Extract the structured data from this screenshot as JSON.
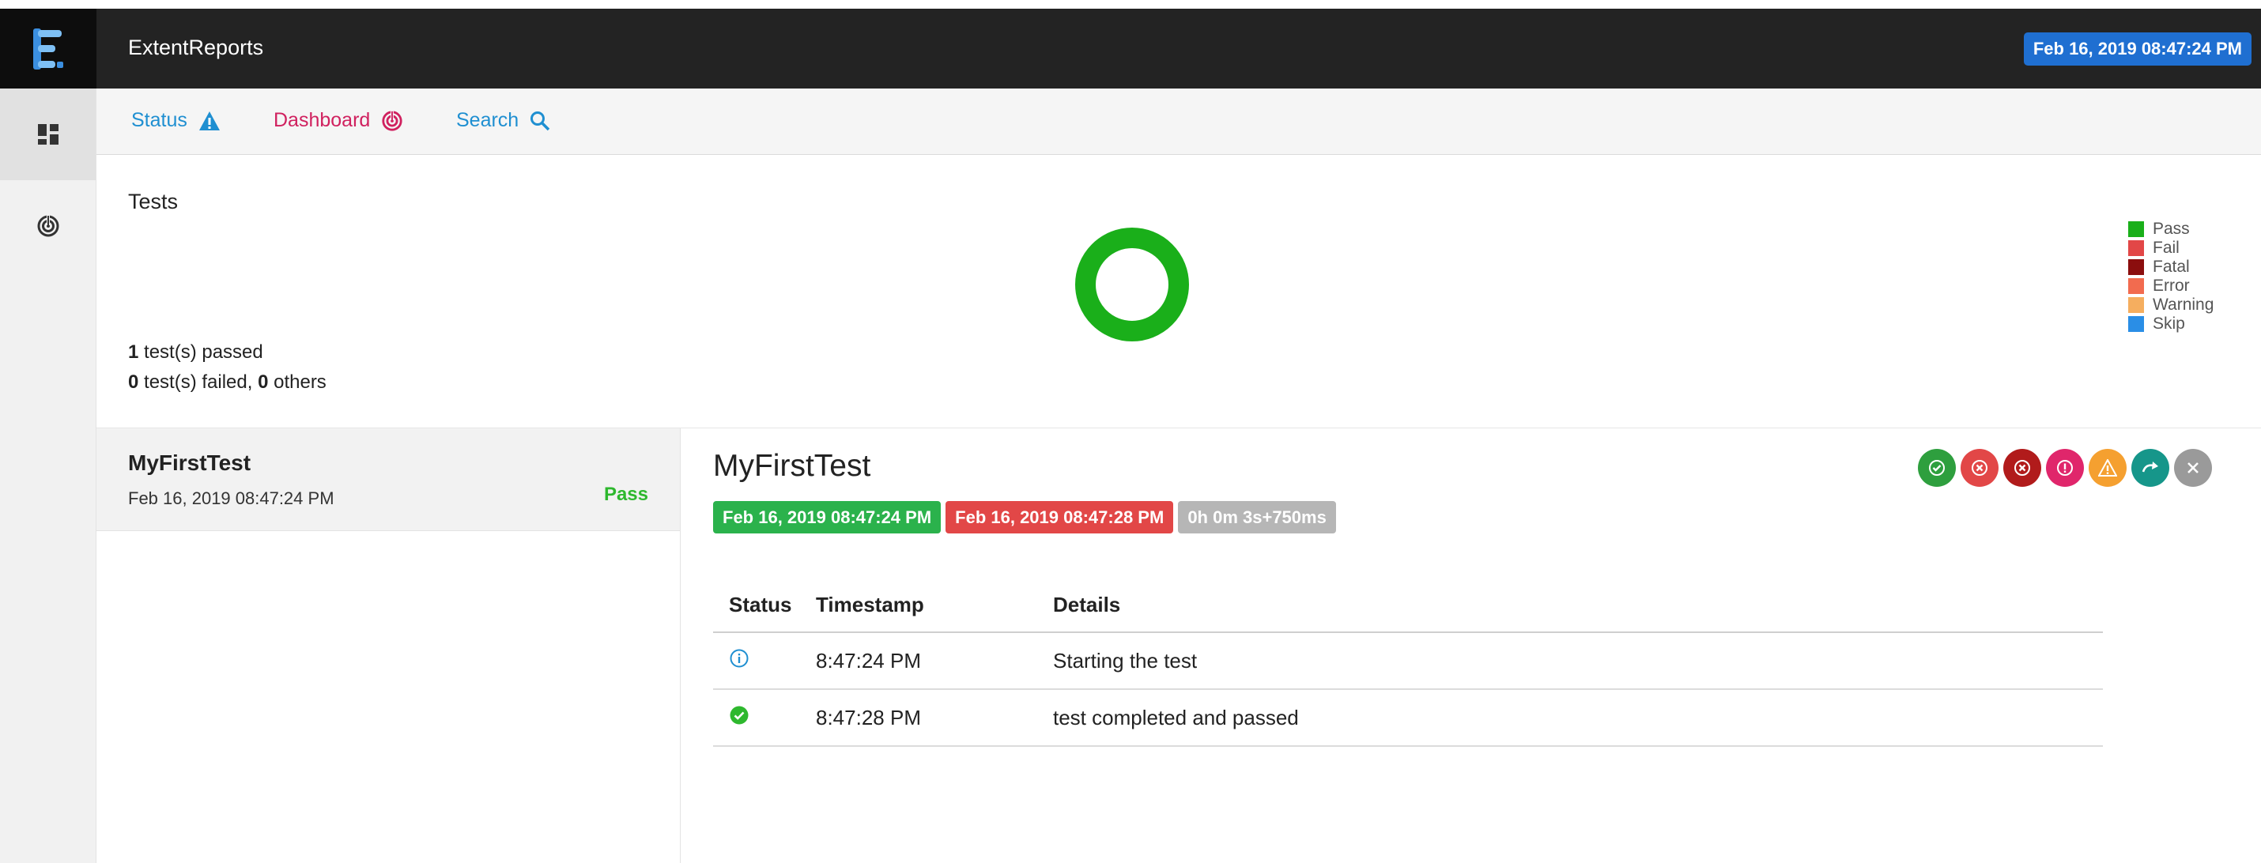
{
  "header": {
    "app_title": "ExtentReports",
    "datetime": "Feb 16, 2019 08:47:24 PM"
  },
  "sidebar": {
    "items": [
      {
        "name": "dashboard-grid-icon",
        "active": true
      },
      {
        "name": "dashboard-target-icon",
        "active": false
      }
    ]
  },
  "nav": {
    "status_label": "Status",
    "dashboard_label": "Dashboard",
    "search_label": "Search",
    "status_color": "#1f8fd1",
    "dashboard_color": "#d0215f",
    "search_color": "#1f8fd1"
  },
  "dashboard": {
    "title": "Tests",
    "passed_count": "1",
    "passed_text": " test(s) passed",
    "failed_count": "0",
    "failed_text": " test(s) failed, ",
    "others_count": "0",
    "others_text": " others",
    "legend": [
      {
        "label": "Pass",
        "color": "#1aaf1a"
      },
      {
        "label": "Fail",
        "color": "#e24747"
      },
      {
        "label": "Fatal",
        "color": "#8b0e0e"
      },
      {
        "label": "Error",
        "color": "#f26b4f"
      },
      {
        "label": "Warning",
        "color": "#f5ae5f"
      },
      {
        "label": "Skip",
        "color": "#2a8ee6"
      }
    ]
  },
  "tests": [
    {
      "name": "MyFirstTest",
      "time": "Feb 16, 2019 08:47:24 PM",
      "status": "Pass"
    }
  ],
  "detail": {
    "title": "MyFirstTest",
    "start_time": "Feb 16, 2019 08:47:24 PM",
    "end_time": "Feb 16, 2019 08:47:28 PM",
    "duration": "0h 0m 3s+750ms",
    "status_filter_icons": [
      {
        "name": "pass-filter-icon",
        "color": "#2e9f3e"
      },
      {
        "name": "fail-filter-icon",
        "color": "#e24747"
      },
      {
        "name": "fatal-filter-icon",
        "color": "#b11b1b"
      },
      {
        "name": "error-filter-icon",
        "color": "#e0266b"
      },
      {
        "name": "warning-filter-icon",
        "color": "#f5a030"
      },
      {
        "name": "skip-filter-icon",
        "color": "#16968a"
      },
      {
        "name": "clear-filter-icon",
        "color": "#9a9a9a"
      }
    ],
    "table": {
      "headers": [
        "Status",
        "Timestamp",
        "Details"
      ],
      "rows": [
        {
          "status_icon": "info-icon",
          "timestamp": "8:47:24 PM",
          "details": "Starting the test"
        },
        {
          "status_icon": "pass-check-icon",
          "timestamp": "8:47:28 PM",
          "details": "test completed and passed"
        }
      ]
    }
  },
  "chart_data": {
    "type": "pie",
    "categories": [
      "Pass",
      "Fail",
      "Fatal",
      "Error",
      "Warning",
      "Skip"
    ],
    "values": [
      1,
      0,
      0,
      0,
      0,
      0
    ],
    "title": "Tests",
    "legend_position": "right"
  }
}
